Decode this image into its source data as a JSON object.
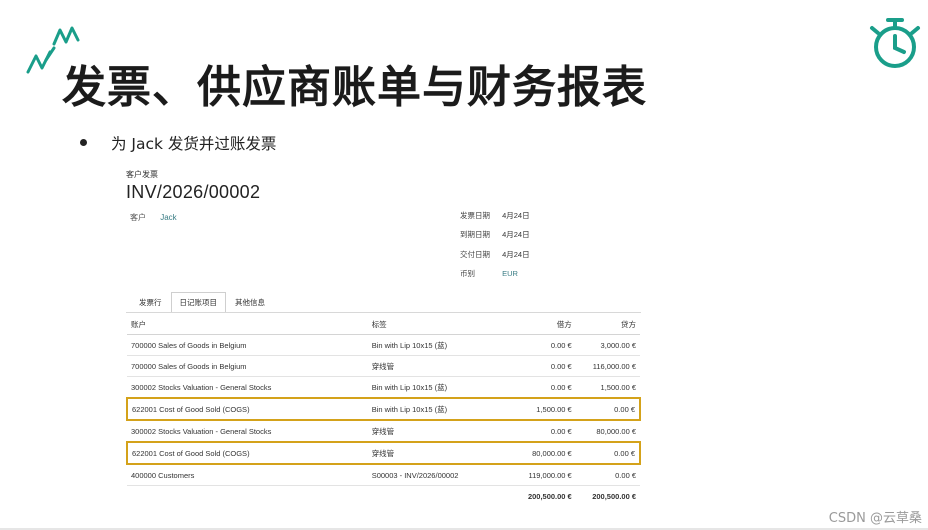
{
  "slide": {
    "title": "发票、供应商账单与财务报表",
    "bullet": "为 Jack 发货并过账发票",
    "watermark": "CSDN @云草桑"
  },
  "colors": {
    "accent_teal": "#1a9e8a",
    "highlight_gold": "#d4a21a",
    "link": "#3a7d85"
  },
  "invoice": {
    "doc_type": "客户发票",
    "number": "INV/2026/00002",
    "customer_label": "客户",
    "customer_value": "Jack",
    "meta": [
      {
        "label": "发票日期",
        "value": "4月24日"
      },
      {
        "label": "到期日期",
        "value": "4月24日"
      },
      {
        "label": "交付日期",
        "value": "4月24日"
      },
      {
        "label": "币别",
        "value": "EUR"
      }
    ],
    "tabs": [
      "发票行",
      "日记账项目",
      "其他信息"
    ],
    "active_tab": "日记账项目",
    "columns": {
      "account": "账户",
      "label": "标签",
      "debit": "借方",
      "credit": "贷方"
    },
    "rows": [
      {
        "account": "700000 Sales of Goods in Belgium",
        "label": "Bin with Lip 10x15 (蓝)",
        "debit": "0.00 €",
        "credit": "3,000.00 €",
        "highlight": false
      },
      {
        "account": "700000 Sales of Goods in Belgium",
        "label": "穿线管",
        "debit": "0.00 €",
        "credit": "116,000.00 €",
        "highlight": false
      },
      {
        "account": "300002 Stocks Valuation - General Stocks",
        "label": "Bin with Lip 10x15 (蓝)",
        "debit": "0.00 €",
        "credit": "1,500.00 €",
        "highlight": false
      },
      {
        "account": "622001 Cost of Good Sold (COGS)",
        "label": "Bin with Lip 10x15 (蓝)",
        "debit": "1,500.00 €",
        "credit": "0.00 €",
        "highlight": true
      },
      {
        "account": "300002 Stocks Valuation - General Stocks",
        "label": "穿线管",
        "debit": "0.00 €",
        "credit": "80,000.00 €",
        "highlight": false
      },
      {
        "account": "622001 Cost of Good Sold (COGS)",
        "label": "穿线管",
        "debit": "80,000.00 €",
        "credit": "0.00 €",
        "highlight": true
      },
      {
        "account": "400000 Customers",
        "label": "S00003 - INV/2026/00002",
        "debit": "119,000.00 €",
        "credit": "0.00 €",
        "highlight": false
      }
    ],
    "totals": {
      "debit": "200,500.00 €",
      "credit": "200,500.00 €"
    }
  }
}
